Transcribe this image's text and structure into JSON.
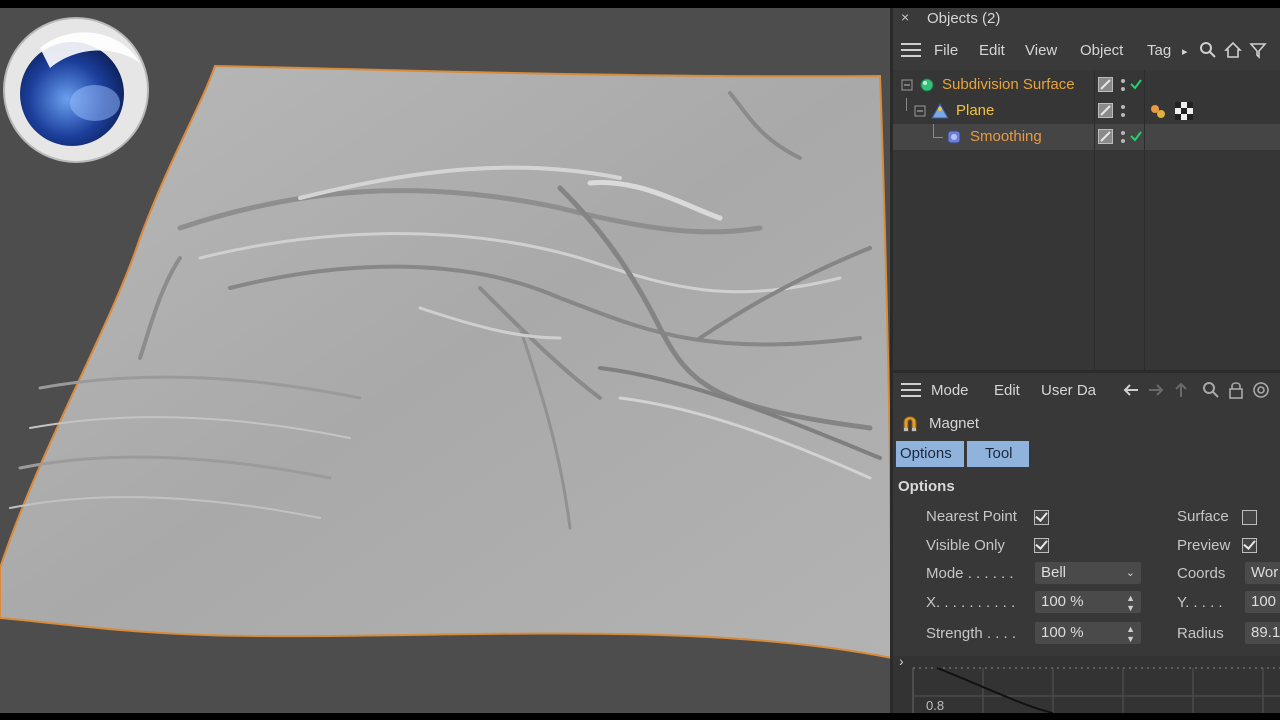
{
  "objects_panel": {
    "title": "Objects (2)",
    "close_glyph": "×",
    "menu": [
      "File",
      "Edit",
      "View",
      "Object",
      "Tag"
    ],
    "menu_more": "▸",
    "toolbar_icons": [
      "search-icon",
      "home-icon",
      "filter-icon"
    ],
    "tree": [
      {
        "name": "Subdivision Surface",
        "color": "#e8a33a",
        "icon": "subdivision-surface-icon"
      },
      {
        "name": "Plane",
        "color": "#f2c23a",
        "icon": "plane-icon"
      },
      {
        "name": "Smoothing",
        "color": "#e89a40",
        "icon": "smoothing-deformer-icon"
      }
    ]
  },
  "attributes_panel": {
    "menu": [
      "Mode",
      "Edit",
      "User Da"
    ],
    "toolbar_icons": [
      "back-arrow-icon",
      "forward-arrow-icon",
      "up-arrow-icon",
      "search-icon",
      "lock-icon",
      "target-icon"
    ],
    "tool_name": "Magnet",
    "tabs": [
      "Options",
      "Tool"
    ],
    "section": "Options",
    "fields": {
      "nearest_point": {
        "label": "Nearest Point",
        "checked": true
      },
      "visible_only": {
        "label": "Visible Only",
        "checked": true
      },
      "surface": {
        "label": "Surface",
        "checked": false
      },
      "preview": {
        "label": "Preview",
        "checked": true
      },
      "mode": {
        "label": "Mode . . . . . .",
        "value": "Bell"
      },
      "coords": {
        "label": "Coords",
        "value": "Wor"
      },
      "x": {
        "label": "X. . . . . . . . . .",
        "value": "100 %"
      },
      "y": {
        "label": "Y. . . . .",
        "value": "100"
      },
      "strength": {
        "label": "Strength . . . .",
        "value": "100 %"
      },
      "radius": {
        "label": "Radius",
        "value": "89.1"
      }
    },
    "graph_label": "0.8",
    "graph_expand": "›"
  },
  "colors": {
    "selection_tab": "#8fb3dc",
    "check": "#2ecc71"
  }
}
